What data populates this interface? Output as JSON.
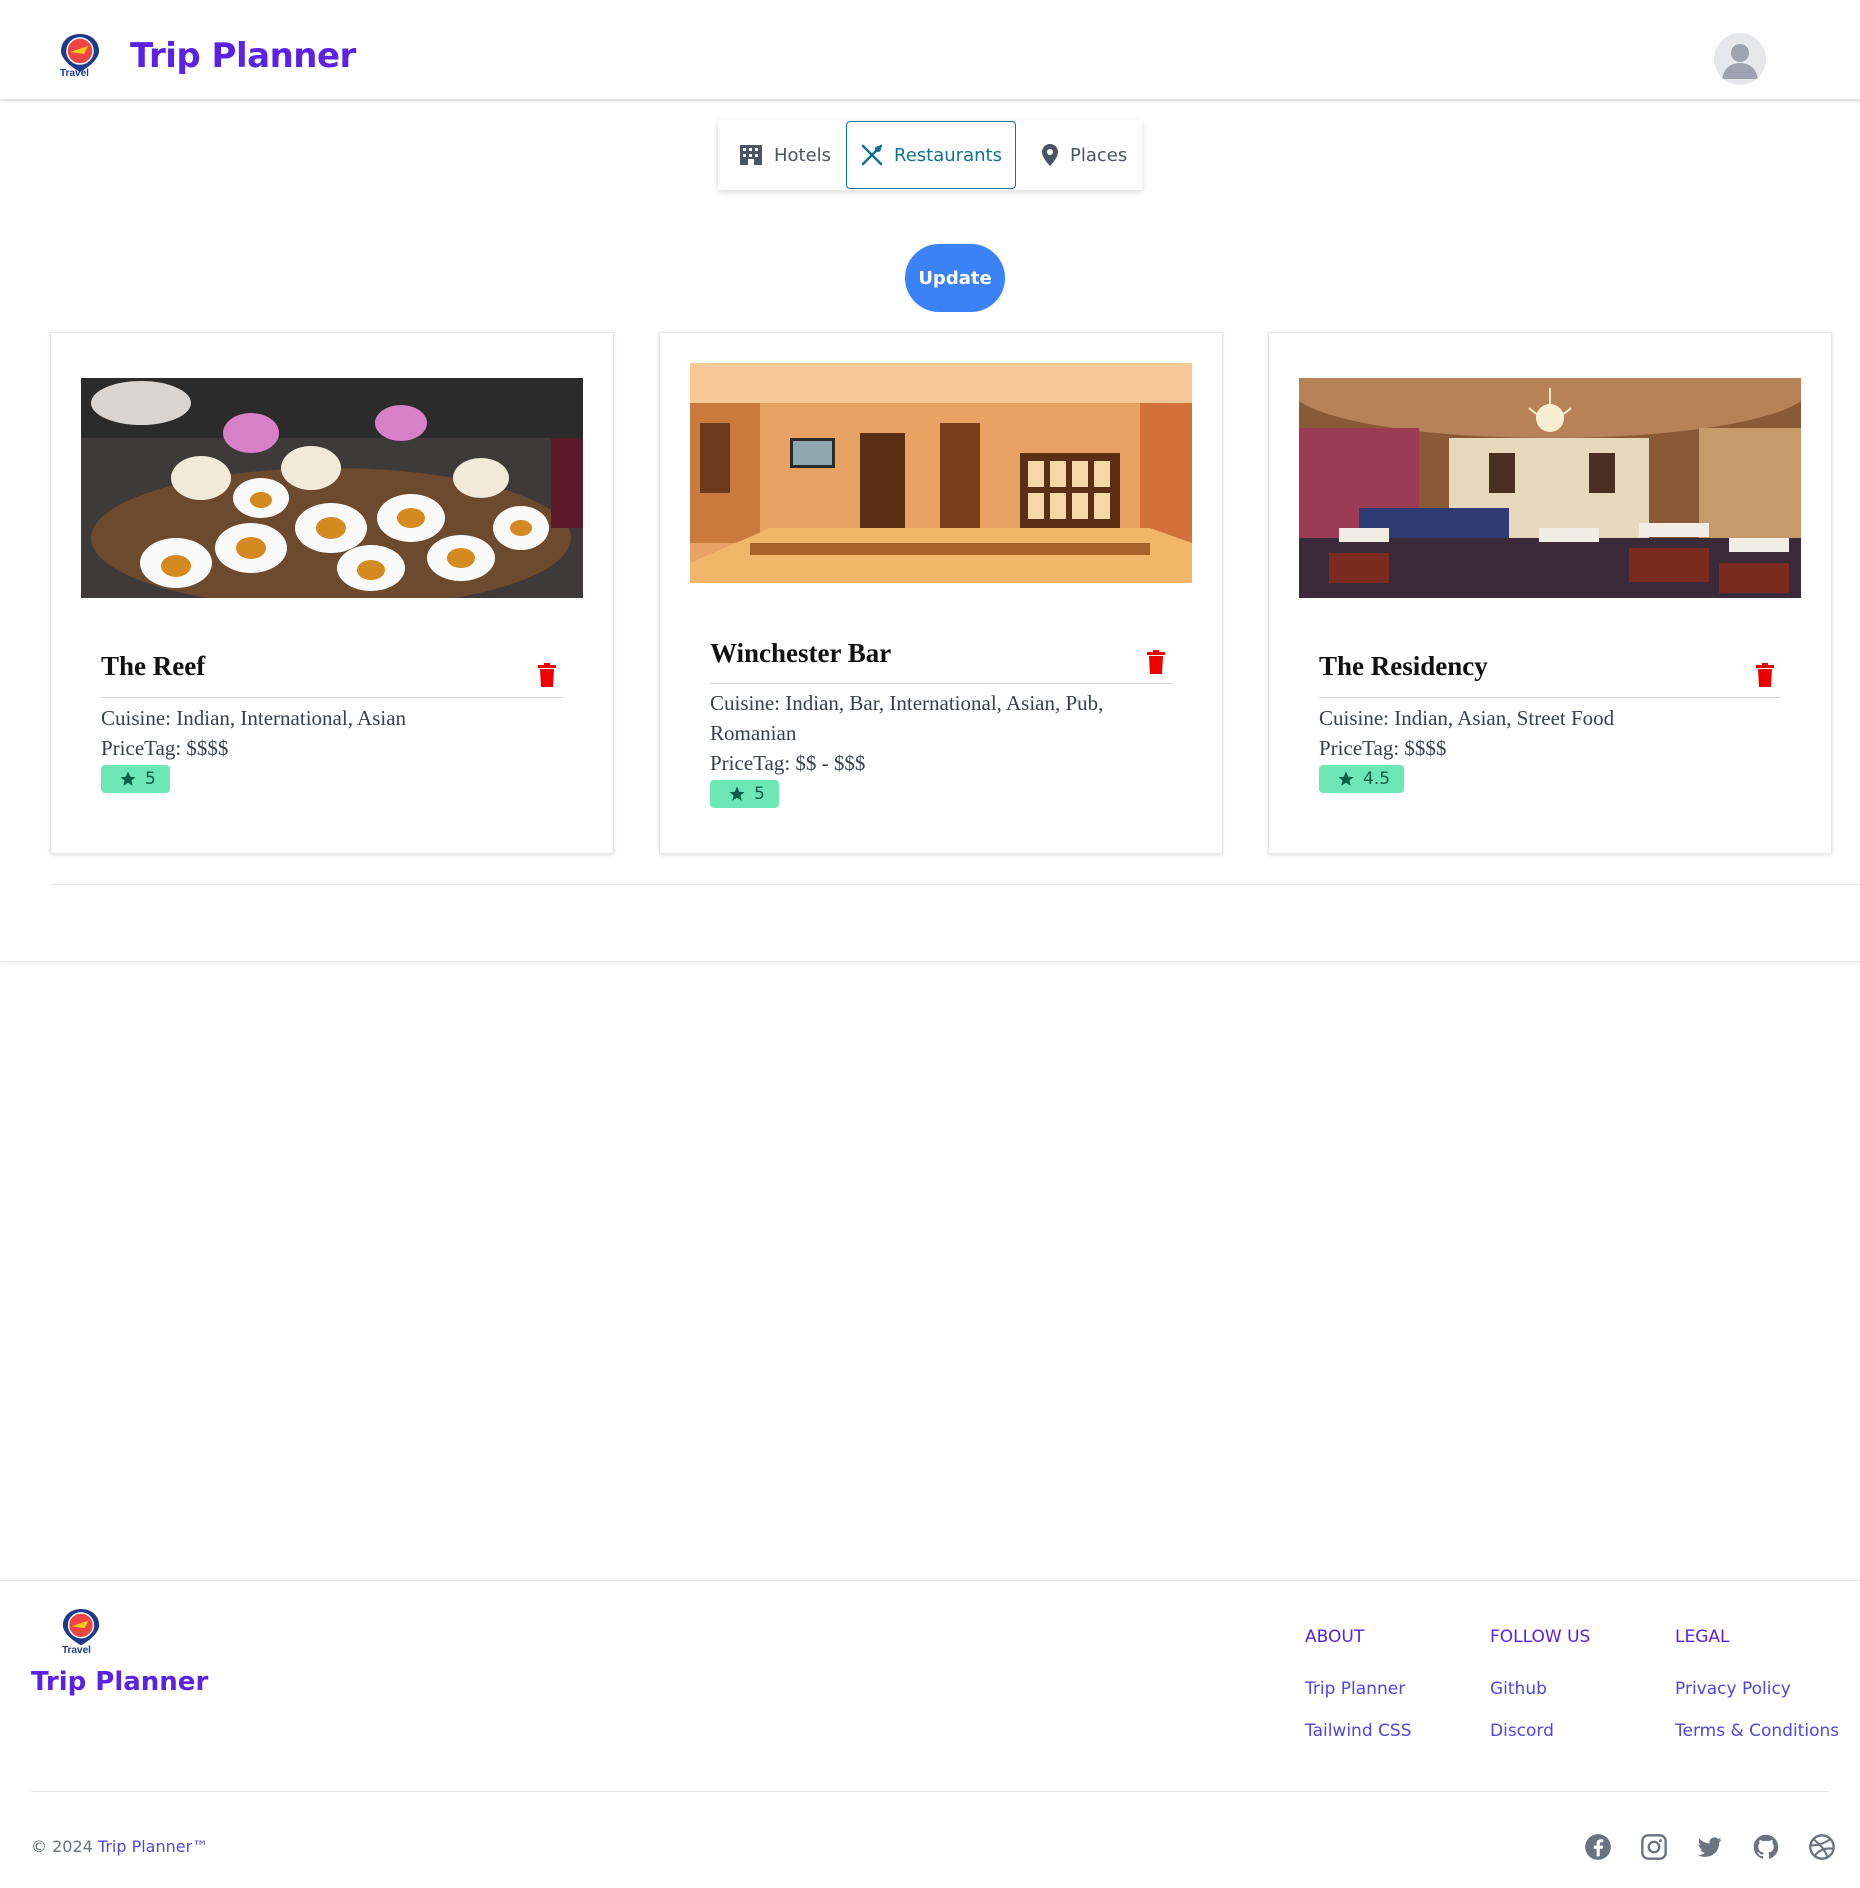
{
  "header": {
    "brand": "Trip Planner",
    "logo_text": "Travel"
  },
  "tabs": [
    {
      "label": "Hotels",
      "icon": "building-icon",
      "active": false
    },
    {
      "label": "Restaurants",
      "icon": "utensils-icon",
      "active": true
    },
    {
      "label": "Places",
      "icon": "map-pin-icon",
      "active": false
    }
  ],
  "update_label": "Update",
  "cards": [
    {
      "title": "The Reef",
      "cuisine": "Cuisine: Indian, International, Asian",
      "price": "PriceTag: $$$$",
      "rating": "5"
    },
    {
      "title": "Winchester Bar",
      "cuisine": "Cuisine: Indian, Bar, International, Asian, Pub, Romanian",
      "price": "PriceTag: $$ - $$$",
      "rating": "5"
    },
    {
      "title": "The Residency",
      "cuisine": "Cuisine: Indian, Asian, Street Food",
      "price": "PriceTag: $$$$",
      "rating": "4.5"
    }
  ],
  "footer": {
    "brand": "Trip Planner",
    "columns": [
      {
        "heading": "ABOUT",
        "links": [
          "Trip Planner",
          "Tailwind CSS"
        ]
      },
      {
        "heading": "FOLLOW US",
        "links": [
          "Github",
          "Discord"
        ]
      },
      {
        "heading": "LEGAL",
        "links": [
          "Privacy Policy",
          "Terms & Conditions"
        ]
      }
    ],
    "copyright_prefix": "© 2024 ",
    "copyright_brand": "Trip Planner™",
    "socials": [
      "facebook-icon",
      "instagram-icon",
      "twitter-icon",
      "github-icon",
      "dribbble-icon"
    ]
  },
  "colors": {
    "brand": "#5b21e6",
    "accent": "#3b82f6",
    "active_tab": "#0e7490",
    "badge_bg": "#6ee7b7",
    "trash": "#ef0000"
  }
}
